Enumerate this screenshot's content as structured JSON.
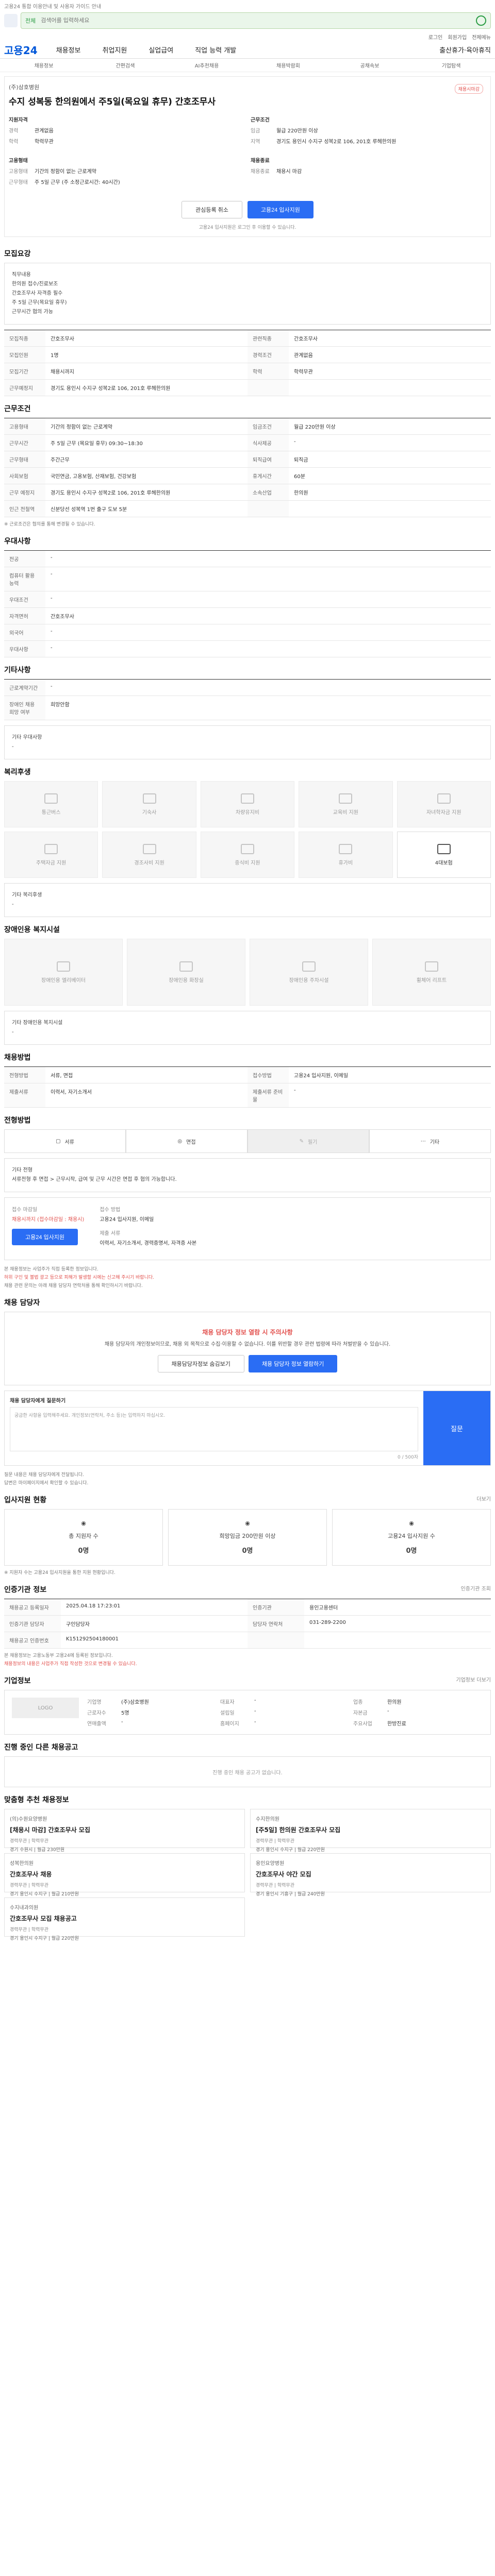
{
  "topbar": {
    "notice": "고용24 통합 이용안내 및 사용자 가이드 안내"
  },
  "search": {
    "mode": "전체",
    "placeholder": "검색어를 입력하세요"
  },
  "util": [
    "로그인",
    "회원가입",
    "전체메뉴"
  ],
  "gnb": {
    "logo": "고용24",
    "items": [
      "채용정보",
      "취업지원",
      "실업급여",
      "직업 능력 개발"
    ],
    "right": "출산휴가·육아휴직"
  },
  "subnav": [
    "채용정보",
    "간편검색",
    "AI추천채용",
    "채용박람회",
    "공채속보",
    "기업탐색"
  ],
  "job": {
    "closing": "채용시마감",
    "company": "(주)삼호병원",
    "title": "수지 성복동 한의원에서 주5일(목요일 휴무) 간호조무사",
    "col1_heading": "지원자격",
    "col1": [
      {
        "k": "경력",
        "v": "관계없음"
      },
      {
        "k": "학력",
        "v": "학력무관"
      }
    ],
    "col2_heading": "근무조건",
    "col2": [
      {
        "k": "임금",
        "v": "월급 220만원 이상"
      },
      {
        "k": "지역",
        "v": "경기도 용인시 수지구 성복2로 106, 201호 루헤한의원"
      }
    ],
    "col3_heading": "고용형태",
    "col3": [
      {
        "k": "고용형태",
        "v": "기간의 정함이 없는 근로계약"
      },
      {
        "k": "근무형태",
        "v": "주 5일 근무 (주 소정근로시간: 40시간)"
      }
    ],
    "col4_heading": "채용종료",
    "col4": [
      {
        "k": "채용종료",
        "v": "채용시 마감"
      }
    ],
    "btn_interest": "관심등록 취소",
    "btn_apply": "고용24 입사지원",
    "note": "고용24 입사지원은 로그인 후 이용할 수 있습니다."
  },
  "summary": {
    "heading": "모집요강",
    "lines": [
      "직무내용",
      "한의원 접수/진료보조",
      "간호조무사 자격증 필수",
      "주 5일 근무(목요일 휴무)",
      "근무시간 협의 가능"
    ],
    "grid": [
      {
        "k": "모집직종",
        "v": "간호조무사"
      },
      {
        "k": "관련직종",
        "v": "간호조무사"
      },
      {
        "k": "모집인원",
        "v": "1명"
      },
      {
        "k": "경력조건",
        "v": "관계없음"
      },
      {
        "k": "모집기간",
        "v": "채용시까지"
      },
      {
        "k": "학력",
        "v": "학력무관"
      },
      {
        "k": "근무예정지",
        "v": "경기도 용인시 수지구 성복2로 106, 201호 루헤한의원"
      },
      {
        "k": "",
        "v": ""
      }
    ]
  },
  "cond": {
    "heading": "근무조건",
    "grid": [
      {
        "k": "고용형태",
        "v": "기간의 정함이 없는 근로계약"
      },
      {
        "k": "임금조건",
        "v": "월급 220만원 이상"
      },
      {
        "k": "근무시간",
        "v": "주 5일 근무 (목요일 휴무) 09:30~18:30"
      },
      {
        "k": "식사제공",
        "v": "-"
      },
      {
        "k": "근무형태",
        "v": "주간근무"
      },
      {
        "k": "퇴직급여",
        "v": "퇴직금"
      },
      {
        "k": "사회보험",
        "v": "국민연금, 고용보험, 산재보험, 건강보험"
      },
      {
        "k": "휴게시간",
        "v": "60분"
      },
      {
        "k": "근무 예정지",
        "v": "경기도 용인시 수지구 성복2로 106, 201호 루헤한의원"
      },
      {
        "k": "소속산업",
        "v": "한의원"
      },
      {
        "k": "인근 전철역",
        "v": "신분당선 성복역 1번 출구 도보 5분"
      },
      {
        "k": "",
        "v": ""
      }
    ],
    "note": "※ 근로조건은 협의를 통해 변경될 수 있습니다."
  },
  "pref": {
    "heading": "우대사항",
    "rows": [
      {
        "k": "전공",
        "v": "-"
      },
      {
        "k": "컴퓨터 활용 능력",
        "v": "-"
      },
      {
        "k": "우대조건",
        "v": "-"
      },
      {
        "k": "자격면허",
        "v": "간호조무사"
      },
      {
        "k": "외국어",
        "v": "-"
      },
      {
        "k": "우대사항",
        "v": "-"
      }
    ]
  },
  "etc": {
    "heading": "기타사항",
    "rows": [
      {
        "k": "근로계약기간",
        "v": "-"
      },
      {
        "k": "장애인 채용 희망 여부",
        "v": "희망안함"
      }
    ],
    "sub": "기타 우대사항",
    "sub_v": "-"
  },
  "welfare": {
    "heading": "복리후생",
    "items": [
      "통근버스",
      "기숙사",
      "차량유지비",
      "교육비 지원",
      "자녀학자금 지원",
      "주택자금 지원",
      "경조사비 지원",
      "중식비 지원",
      "휴가비",
      "4대보험"
    ],
    "active": [
      9
    ],
    "sub": "기타 복리후생",
    "sub_v": "-"
  },
  "disabled": {
    "heading": "장애인용 복지시설",
    "items": [
      "장애인용 엘리베이터",
      "장애인용 화장실",
      "장애인용 주차시설",
      "휠체어 리프트"
    ],
    "sub": "기타 장애인용 복지시설",
    "sub_v": "-"
  },
  "process": {
    "heading": "채용방법",
    "rows": [
      {
        "k": "전형방법",
        "v": "서류, 면접"
      },
      {
        "k": "접수방법",
        "v": "고용24 입사지원, 이메일"
      },
      {
        "k": "제출서류",
        "v": "이력서, 자기소개서"
      },
      {
        "k": "제출서류 준비물",
        "v": "-"
      }
    ]
  },
  "steps": {
    "heading": "전형방법",
    "items": [
      {
        "label": "서류",
        "dim": false
      },
      {
        "label": "면접",
        "dim": false
      },
      {
        "label": "필기",
        "dim": true
      },
      {
        "label": "기타",
        "dim": false
      }
    ],
    "sub": "기타 전형",
    "sub_v": "서류전형 후 면접 > 근무시작, 급여 및 근무 시간은 면접 후 협의 가능합니다."
  },
  "apply": {
    "k1": "접수 마감일",
    "v1": "채용시까지 (접수마감일 : 채용시)",
    "k2": "접수 방법",
    "v2": "고용24 입사지원, 이메일",
    "k3": "제출 서류",
    "v3": "이력서, 자기소개서, 경력증명서, 자격증 사본",
    "btn": "고용24 입사지원",
    "bullets": [
      "본 채용정보는 사업주가 직접 등록한 정보입니다.",
      "허위 구인 및 불법 광고 등으로 피해가 발생할 시에는 신고해 주시기 바랍니다.",
      "채용 관련 문의는 아래 채용 담당자 연락처를 통해 확인하시기 바랍니다."
    ]
  },
  "contact": {
    "heading": "채용 담당자",
    "title": "채용 담당자 정보 열람 시 주의사항",
    "desc": "채용 담당자의 개인정보이므로, 채용 외 목적으로 수집·이용할 수 없습니다. 이를 위반할 경우 관련 법령에 따라 처벌받을 수 있습니다.",
    "btn1": "채용담당자정보 숨김보기",
    "btn2": "채용 담당자 정보 열람하기",
    "qna_label": "채용 담당자에게 질문하기",
    "qna_placeholder": "궁금한 사항을 입력해주세요. 개인정보(연락처, 주소 등)는 입력하지 마십시오.",
    "qna_count": "0 / 500자",
    "qna_btn": "질문",
    "qna_notes": [
      "질문 내용은 채용 담당자에게 전달됩니다.",
      "답변은 마이페이지에서 확인할 수 있습니다."
    ]
  },
  "stats": {
    "heading": "입사지원 현황",
    "more": "더보기",
    "items": [
      {
        "label": "총 지원자 수",
        "n": "0명"
      },
      {
        "label": "희망임금 200만원 이상",
        "n": "0명"
      },
      {
        "label": "고용24 입사지원 수",
        "n": "0명"
      }
    ],
    "note": "※ 지원자 수는 고용24 입사지원을 통한 지원 현황입니다."
  },
  "info": {
    "heading": "인증기관 정보",
    "btn": "인증기관 조회",
    "grid": [
      {
        "k": "채용공고 등록일자",
        "v": "2025.04.18 17:23:01"
      },
      {
        "k": "인증기관",
        "v": "용인고용센터"
      },
      {
        "k": "인증기관 담당자",
        "v": "구인담당자"
      },
      {
        "k": "담당자 연락처",
        "v": "031-289-2200"
      },
      {
        "k": "채용공고 인증번호",
        "v": "K151292504180001"
      },
      {
        "k": "",
        "v": ""
      }
    ],
    "notes": [
      "본 채용정보는 고용노동부 고용24에 등록된 정보입니다.",
      "채용정보의 내용은 사업주가 직접 작성한 것으로 변경될 수 있습니다."
    ]
  },
  "corp": {
    "heading": "기업정보",
    "more": "기업정보 더보기",
    "logo": "LOGO",
    "rows": [
      {
        "k": "기업명",
        "v": "(주)삼호병원"
      },
      {
        "k": "대표자",
        "v": "-"
      },
      {
        "k": "업종",
        "v": "한의원"
      },
      {
        "k": "근로자수",
        "v": "5명"
      },
      {
        "k": "설립일",
        "v": "-"
      },
      {
        "k": "자본금",
        "v": "-"
      },
      {
        "k": "연매출액",
        "v": "-"
      },
      {
        "k": "홈페이지",
        "v": "-"
      },
      {
        "k": "주요사업",
        "v": "한방진료"
      }
    ]
  },
  "other_jobs": {
    "heading": "진행 중인 다른 채용공고",
    "empty": "진행 중인 채용 공고가 없습니다."
  },
  "recommend": {
    "heading": "맞춤형 추천 채용정보",
    "jobs": [
      {
        "company": "(의)수원요양병원",
        "title": "[채용시 마감] 간호조무사 모집",
        "meta": "경력무관 | 학력무관",
        "sub": "경기 수원시 | 월급 230만원"
      },
      {
        "company": "수지한의원",
        "title": "[주5일] 한의원 간호조무사 모집",
        "meta": "경력무관 | 학력무관",
        "sub": "경기 용인시 수지구 | 월급 220만원"
      },
      {
        "company": "성복한의원",
        "title": "간호조무사 채용",
        "meta": "경력무관 | 학력무관",
        "sub": "경기 용인시 수지구 | 월급 210만원"
      },
      {
        "company": "용인요양병원",
        "title": "간호조무사 야간 모집",
        "meta": "경력무관 | 학력무관",
        "sub": "경기 용인시 기흥구 | 월급 240만원"
      },
      {
        "company": "수지내과의원",
        "title": "간호조무사 모집 채용공고",
        "meta": "경력무관 | 학력무관",
        "sub": "경기 용인시 수지구 | 월급 220만원"
      }
    ]
  }
}
